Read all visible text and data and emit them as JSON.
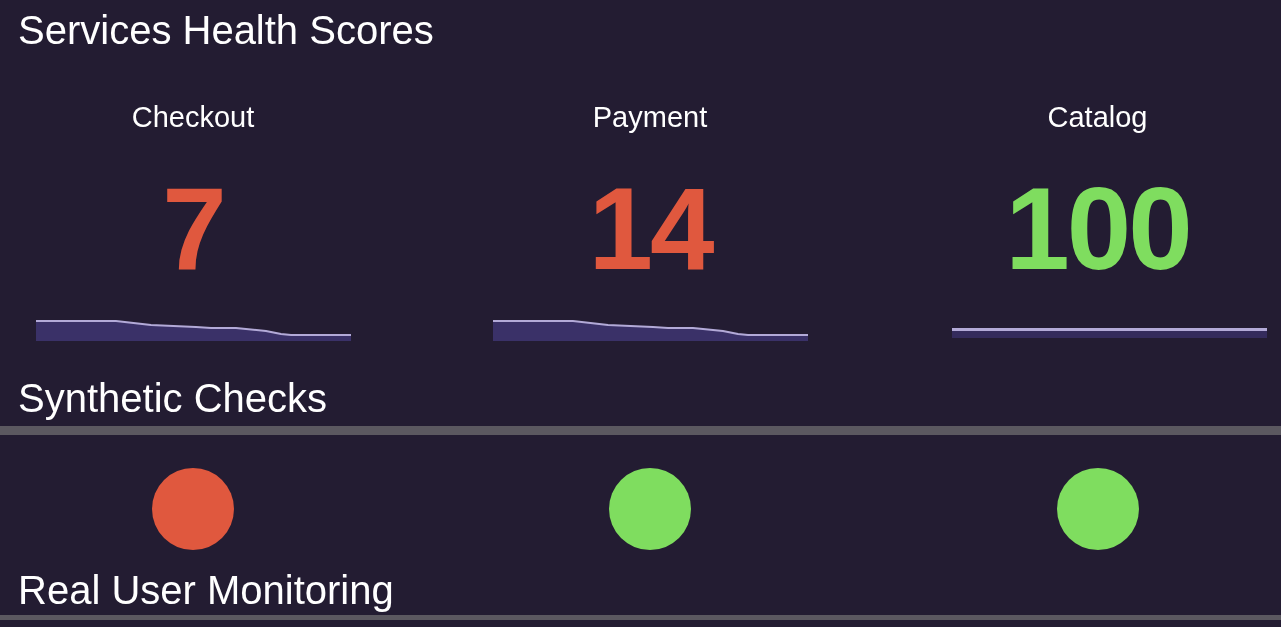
{
  "health_scores": {
    "title": "Services Health Scores",
    "services": [
      {
        "name": "Checkout",
        "score": "7",
        "color": "#e0583e",
        "kind": "declining"
      },
      {
        "name": "Payment",
        "score": "14",
        "color": "#e0583e",
        "kind": "declining"
      },
      {
        "name": "Catalog",
        "score": "100",
        "color": "#7fdd5f",
        "kind": "flat"
      }
    ]
  },
  "synthetic_checks": {
    "title": "Synthetic Checks",
    "checks": [
      {
        "color": "#e0583e"
      },
      {
        "color": "#7fdd5f"
      },
      {
        "color": "#7fdd5f"
      }
    ]
  },
  "real_user_monitoring": {
    "title": "Real User Monitoring"
  }
}
